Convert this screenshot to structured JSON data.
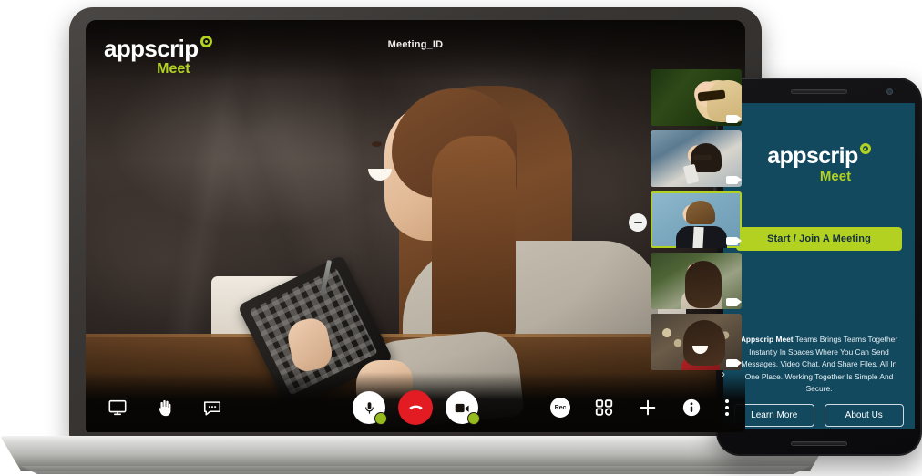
{
  "laptop": {
    "header": {
      "logo_main": "appscrip",
      "logo_sub": "Meet",
      "meeting_id": "Meeting_ID"
    },
    "toolbar_left": [
      {
        "name": "screen-share-icon",
        "label": "Share Screen"
      },
      {
        "name": "raise-hand-icon",
        "label": "Raise Hand"
      },
      {
        "name": "chat-icon",
        "label": "Chat"
      }
    ],
    "toolbar_center": [
      {
        "name": "microphone-button",
        "label": "Microphone",
        "state": "on"
      },
      {
        "name": "end-call-button",
        "label": "End Call",
        "state": "active"
      },
      {
        "name": "camera-button",
        "label": "Camera",
        "state": "on"
      }
    ],
    "toolbar_right": [
      {
        "name": "record-button",
        "label": "Rec"
      },
      {
        "name": "grid-layout-button",
        "label": "Layout"
      },
      {
        "name": "add-participant-button",
        "label": "Add"
      },
      {
        "name": "info-button",
        "label": "i"
      },
      {
        "name": "more-options-button",
        "label": "More"
      }
    ],
    "filmstrip": {
      "collapse_label": "Collapse",
      "participants": [
        {
          "id": "participant-1",
          "scene": "blonde-woman-sunglasses",
          "camera": "on",
          "active": false
        },
        {
          "id": "participant-2",
          "scene": "woman-glasses-phone",
          "camera": "on",
          "active": false
        },
        {
          "id": "participant-3",
          "scene": "man-in-suit",
          "camera": "on",
          "active": true
        },
        {
          "id": "participant-4",
          "scene": "woman-outdoors",
          "camera": "on",
          "active": false
        },
        {
          "id": "participant-5",
          "scene": "smiling-woman-red",
          "camera": "on",
          "active": false
        }
      ]
    },
    "main_video": {
      "scene": "woman-smiling-with-tablet-at-table"
    }
  },
  "phone": {
    "logo_main": "appscrip",
    "logo_sub": "Meet",
    "cta_label": "Start / Join A Meeting",
    "copy_bold": "Appscrip Meet",
    "copy_text": " Teams Brings Teams Together Instantly In Spaces Where You Can Send Messages, Video Chat, And Share Files, All In One Place. Working Together Is Simple And Secure.",
    "buttons": [
      {
        "name": "learn-more-button",
        "label": "Learn More"
      },
      {
        "name": "about-us-button",
        "label": "About Us"
      }
    ]
  },
  "colors": {
    "brand_green": "#b2d121",
    "phone_bg": "#12495f",
    "end_call_red": "#e31b23",
    "mic_on_green": "#96bb1f"
  }
}
